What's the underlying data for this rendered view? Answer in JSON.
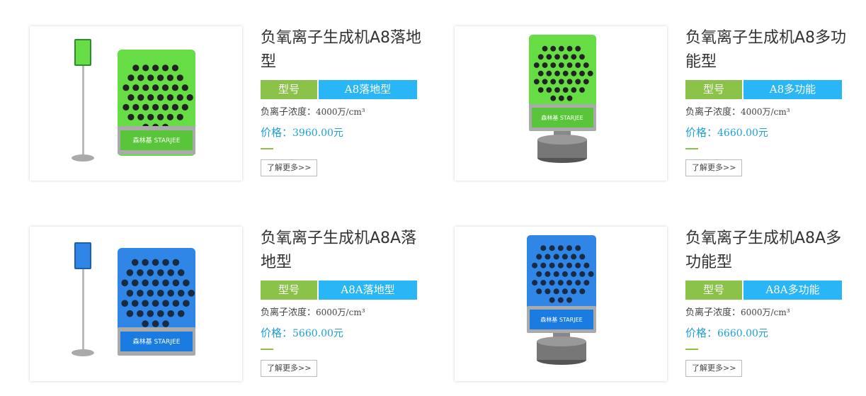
{
  "products": [
    {
      "title": "负氧离子生成机A8落地型",
      "model_key": "型号",
      "model_value": "A8落地型",
      "concentration_label": "负离子浓度：",
      "concentration_value": "4000万/cm³",
      "price_label": "价格：",
      "price_value": "3960.00元",
      "more_label": "了解更多>>",
      "image": {
        "device_color": "#66dd44",
        "style": "floor-stand"
      }
    },
    {
      "title": "负氧离子生成机A8多功能型",
      "model_key": "型号",
      "model_value": "A8多功能",
      "concentration_label": "负离子浓度：",
      "concentration_value": "4000万/cm³",
      "price_label": "价格：",
      "price_value": "4660.00元",
      "more_label": "了解更多>>",
      "image": {
        "device_color": "#66dd44",
        "style": "desktop-base"
      }
    },
    {
      "title": "负氧离子生成机A8A落地型",
      "model_key": "型号",
      "model_value": "A8A落地型",
      "concentration_label": "负离子浓度：",
      "concentration_value": "6000万/cm³",
      "price_label": "价格：",
      "price_value": "5660.00元",
      "more_label": "了解更多>>",
      "image": {
        "device_color": "#2f86e6",
        "style": "floor-stand"
      }
    },
    {
      "title": "负氧离子生成机A8A多功能型",
      "model_key": "型号",
      "model_value": "A8A多功能",
      "concentration_label": "负离子浓度：",
      "concentration_value": "6000万/cm³",
      "price_label": "价格：",
      "price_value": "6660.00元",
      "more_label": "了解更多>>",
      "image": {
        "device_color": "#2f86e6",
        "style": "desktop-base"
      }
    }
  ],
  "colors": {
    "model_key_bg": "#8bc34a",
    "model_value_bg": "#29b6f6",
    "price_text": "#1ea0d8",
    "accent_dash": "#8bc34a"
  }
}
